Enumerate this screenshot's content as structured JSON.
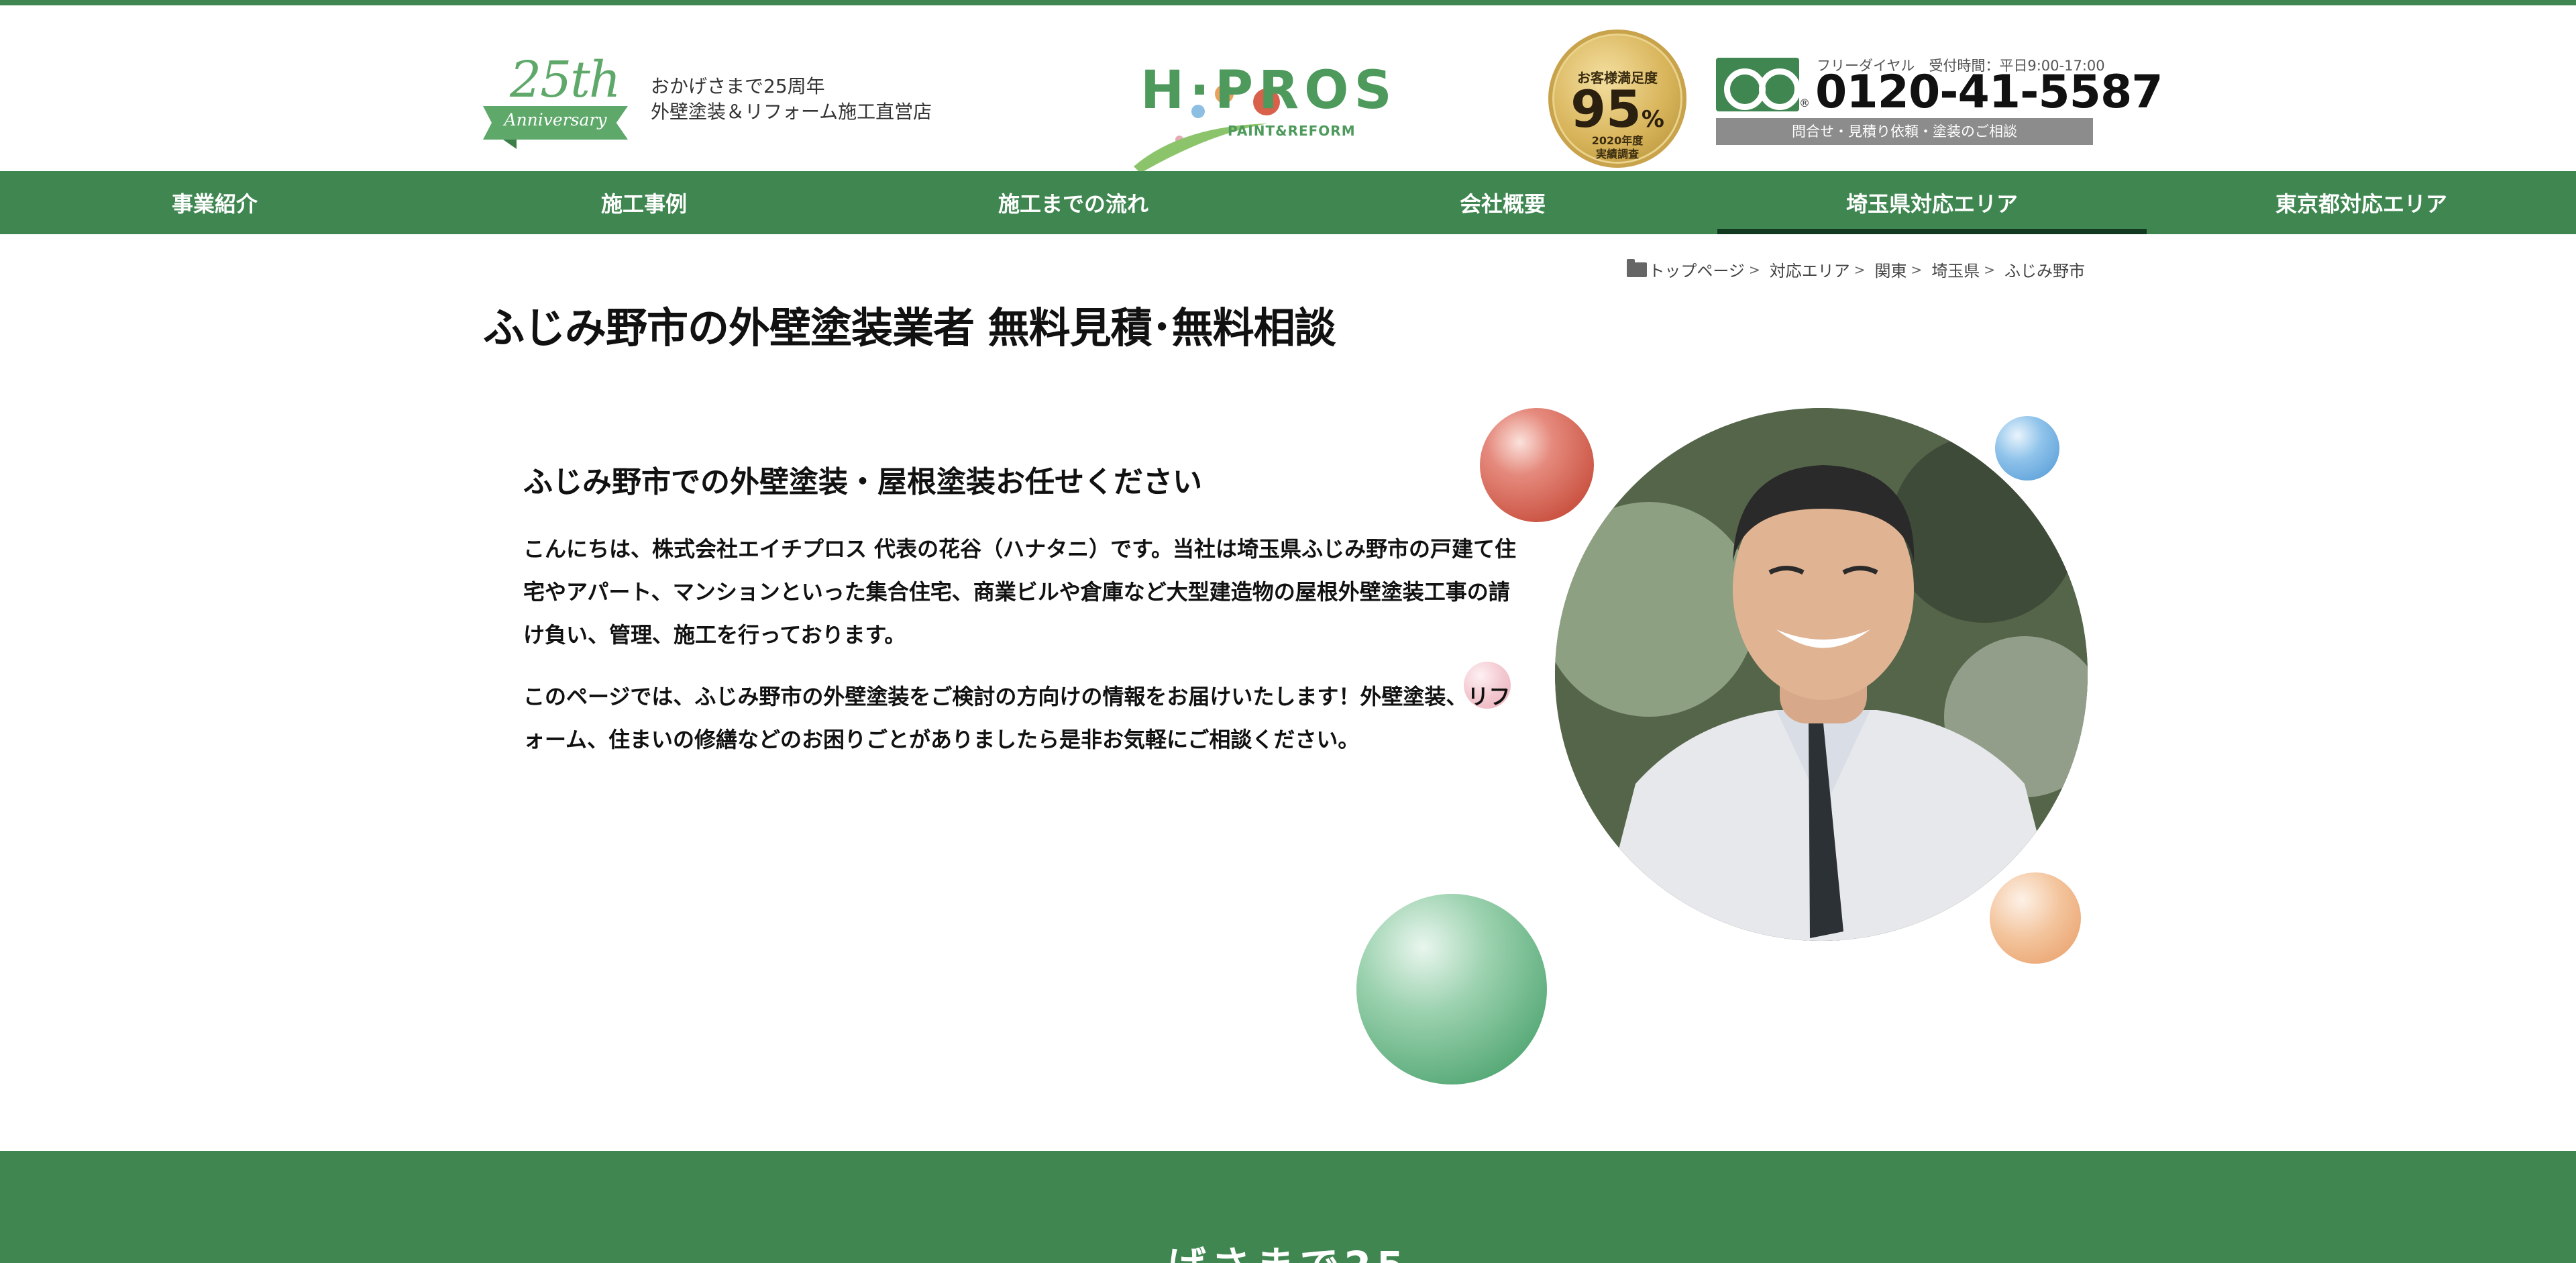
{
  "header": {
    "anniversary": {
      "number": "25th",
      "word": "Anniversary"
    },
    "tagline": [
      "おかげさまで25周年",
      "外壁塗装＆リフォーム施工直営店"
    ],
    "logo": {
      "text": "H·PROS",
      "sub": "PAINT&REFORM"
    },
    "badge": {
      "top": "お客様満足度",
      "value": "95",
      "unit": "%",
      "foot1": "2020年度",
      "foot2": "実績調査"
    },
    "phone": {
      "hours": "フリーダイヤル　受付時間：平日9:00-17:00",
      "number": "0120-41-5587",
      "reg_mark": "®",
      "bar": "問合せ・見積り依頼・塗装のご相談",
      "icon": "free-dial-icon"
    }
  },
  "nav": {
    "items": [
      {
        "label": "事業紹介"
      },
      {
        "label": "施工事例"
      },
      {
        "label": "施工までの流れ"
      },
      {
        "label": "会社概要"
      },
      {
        "label": "埼玉県対応エリア"
      },
      {
        "label": "東京都対応エリア"
      }
    ],
    "active_index": 4
  },
  "breadcrumb": {
    "icon": "folder-icon",
    "items": [
      "トップページ",
      "対応エリア",
      "関東",
      "埼玉県",
      "ふじみ野市"
    ],
    "separator": ">"
  },
  "page_title": "ふじみ野市の外壁塗装業者 無料見積･無料相談",
  "intro": {
    "heading": "ふじみ野市での外壁塗装・屋根塗装お任せください",
    "paragraph1": "こんにちは、株式会社エイチプロス 代表の花谷（ハナタニ）です。当社は埼玉県ふじみ野市の戸建て住宅やアパート、マンションといった集合住宅、商業ビルや倉庫など大型建造物の屋根外壁塗装工事の請け負い、管理、施工を行っております。",
    "paragraph2": "このページでは、ふじみ野市の外壁塗装をご検討の方向けの情報をお届けいたします！外壁塗装、リフォーム、住まいの修繕などのお困りごとがありましたら是非お気軽にご相談ください。"
  },
  "band": {
    "partial_text": "げさまで25"
  },
  "colors": {
    "brand_green": "#3f8650",
    "nav_active_underline": "#123a20",
    "phone_bar": "#8c8c8c"
  }
}
